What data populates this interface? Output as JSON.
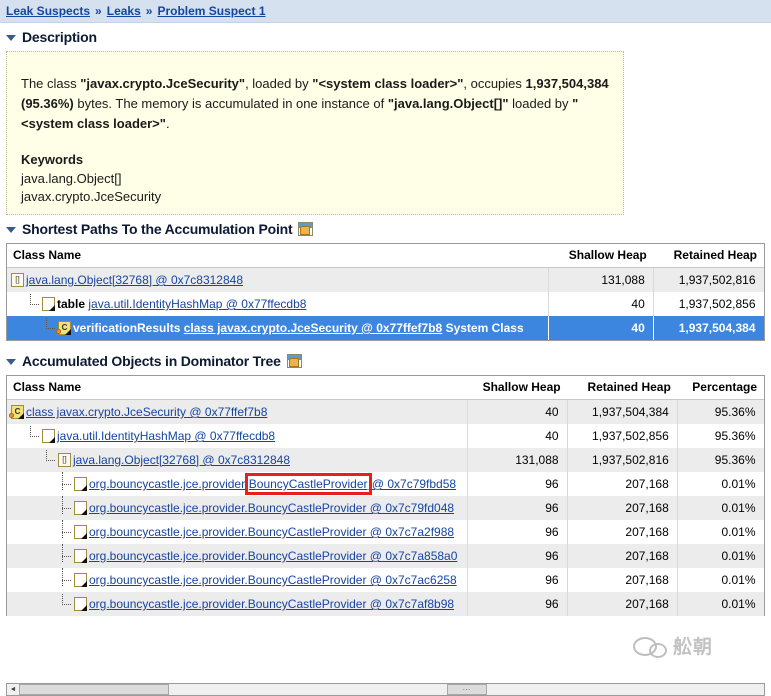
{
  "breadcrumb": {
    "separator": "»",
    "items": [
      {
        "label": "Leak Suspects"
      },
      {
        "label": "Leaks"
      },
      {
        "label": "Problem Suspect 1"
      }
    ]
  },
  "description_section": {
    "title": "Description",
    "body": {
      "p1_a": "The class ",
      "p1_b": "\"javax.crypto.JceSecurity\"",
      "p1_c": ", loaded by ",
      "p1_d": "\"<system class loader>\"",
      "p1_e": ", occupies ",
      "p1_f": "1,937,504,384 (95.36%)",
      "p1_g": " bytes. The memory is accumulated in one instance of ",
      "p1_h": "\"java.lang.Object[]\"",
      "p1_i": " loaded by ",
      "p1_j": "\"<system class loader>\"",
      "p1_k": "."
    },
    "keywords_label": "Keywords",
    "keywords": [
      "java.lang.Object[]",
      "javax.crypto.JceSecurity"
    ]
  },
  "shortest_paths_section": {
    "title": "Shortest Paths To the Accumulation Point",
    "icon": "window-pointer-icon",
    "columns": [
      "Class Name",
      "Shallow Heap",
      "Retained Heap"
    ],
    "rows": [
      {
        "icon": "array-icon",
        "indent": 0,
        "prefix": "",
        "link": "java.lang.Object[32768] @ 0x7c8312848",
        "suffix": "",
        "shallow": "131,088",
        "retained": "1,937,502,816",
        "selected": false,
        "alt": true
      },
      {
        "icon": "document-icon",
        "indent": 1,
        "prefix": "table",
        "link": "java.util.IdentityHashMap @ 0x77ffecdb8",
        "suffix": "",
        "shallow": "40",
        "retained": "1,937,502,856",
        "selected": false,
        "alt": false
      },
      {
        "icon": "class-icon",
        "indent": 2,
        "prefix": "verificationResults",
        "link": "class javax.crypto.JceSecurity @ 0x77ffef7b8",
        "suffix": "System Class",
        "shallow": "40",
        "retained": "1,937,504,384",
        "selected": true,
        "alt": false
      }
    ]
  },
  "dominator_section": {
    "title": "Accumulated Objects in Dominator Tree",
    "icon": "window-pointer-icon",
    "columns": [
      "Class Name",
      "Shallow Heap",
      "Retained Heap",
      "Percentage"
    ],
    "rows": [
      {
        "icon": "class-icon",
        "indent": 0,
        "link": "class javax.crypto.JceSecurity @ 0x77ffef7b8",
        "shallow": "40",
        "retained": "1,937,504,384",
        "percentage": "95.36%",
        "alt": true,
        "highlight": false
      },
      {
        "icon": "document-icon",
        "indent": 1,
        "link": "java.util.IdentityHashMap @ 0x77ffecdb8",
        "shallow": "40",
        "retained": "1,937,502,856",
        "percentage": "95.36%",
        "alt": false,
        "highlight": false
      },
      {
        "icon": "array-icon",
        "indent": 2,
        "link": "java.lang.Object[32768] @ 0x7c8312848",
        "shallow": "131,088",
        "retained": "1,937,502,816",
        "percentage": "95.36%",
        "alt": true,
        "highlight": false
      },
      {
        "icon": "document-icon",
        "indent": 3,
        "link": "org.bouncycastle.jce.provider.BouncyCastleProvider @ 0x7c79fbd58",
        "shallow": "96",
        "retained": "207,168",
        "percentage": "0.01%",
        "alt": false,
        "highlight": true
      },
      {
        "icon": "document-icon",
        "indent": 3,
        "link": "org.bouncycastle.jce.provider.BouncyCastleProvider @ 0x7c79fd048",
        "shallow": "96",
        "retained": "207,168",
        "percentage": "0.01%",
        "alt": true,
        "highlight": false
      },
      {
        "icon": "document-icon",
        "indent": 3,
        "link": "org.bouncycastle.jce.provider.BouncyCastleProvider @ 0x7c7a2f988",
        "shallow": "96",
        "retained": "207,168",
        "percentage": "0.01%",
        "alt": false,
        "highlight": false
      },
      {
        "icon": "document-icon",
        "indent": 3,
        "link": "org.bouncycastle.jce.provider.BouncyCastleProvider @ 0x7c7a858a0",
        "shallow": "96",
        "retained": "207,168",
        "percentage": "0.01%",
        "alt": true,
        "highlight": false
      },
      {
        "icon": "document-icon",
        "indent": 3,
        "link": "org.bouncycastle.jce.provider.BouncyCastleProvider @ 0x7c7ac6258",
        "shallow": "96",
        "retained": "207,168",
        "percentage": "0.01%",
        "alt": false,
        "highlight": false
      },
      {
        "icon": "document-icon",
        "indent": 3,
        "link": "org.bouncycastle.jce.provider.BouncyCastleProvider @ 0x7c7af8b98",
        "shallow": "96",
        "retained": "207,168",
        "percentage": "0.01%",
        "alt": true,
        "highlight": false
      }
    ],
    "highlight_word": "BouncyCastleProvider"
  },
  "scrollbar": {
    "left_arrow": "◄",
    "right_arrow": "►",
    "thumb_grip": "⋯"
  },
  "watermark": {
    "text": "舩朝"
  },
  "colors": {
    "breadcrumb_bg": "#d5e1ef",
    "link": "#1446a0",
    "selection": "#3d86e0",
    "description_bg": "#ffffe8",
    "annotation_red": "#e8201c",
    "row_alt": "#ececec"
  }
}
